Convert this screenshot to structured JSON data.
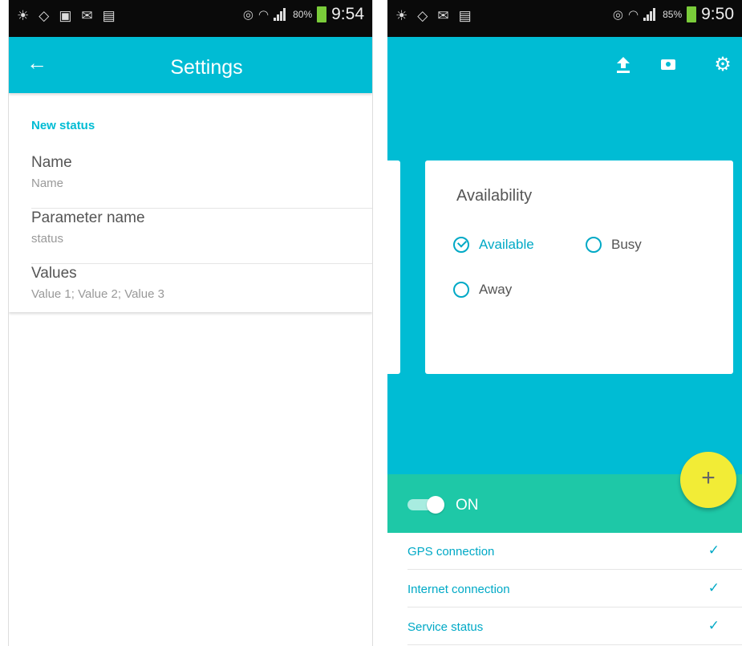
{
  "left_screen": {
    "status_bar": {
      "battery": "80%",
      "time": "9:54"
    },
    "app_bar": {
      "title": "Settings",
      "back_icon": "arrow-left"
    },
    "section_label": "New status",
    "settings": [
      {
        "title": "Name",
        "subtitle": "Name"
      },
      {
        "title": "Parameter name",
        "subtitle": "status"
      },
      {
        "title": "Values",
        "subtitle": "Value 1; Value 2; Value 3"
      }
    ]
  },
  "right_screen": {
    "status_bar": {
      "battery": "85%",
      "time": "9:50"
    },
    "toolbar_icons": [
      "upload-icon",
      "camera-icon",
      "gear-icon"
    ],
    "availability": {
      "title": "Availability",
      "options": [
        {
          "label": "Available",
          "checked": true
        },
        {
          "label": "Busy",
          "checked": false
        },
        {
          "label": "Away",
          "checked": false
        }
      ]
    },
    "fab_label": "+",
    "toggle": {
      "label": "ON",
      "on": true
    },
    "checks": [
      {
        "label": "GPS connection",
        "mark": "✓"
      },
      {
        "label": "Internet connection",
        "mark": "✓"
      },
      {
        "label": "Service status",
        "mark": "✓"
      }
    ]
  },
  "colors": {
    "teal": "#00bcd4",
    "green": "#1ec8a7",
    "fab": "#f2ec36",
    "accent_text": "#00a9c6"
  }
}
